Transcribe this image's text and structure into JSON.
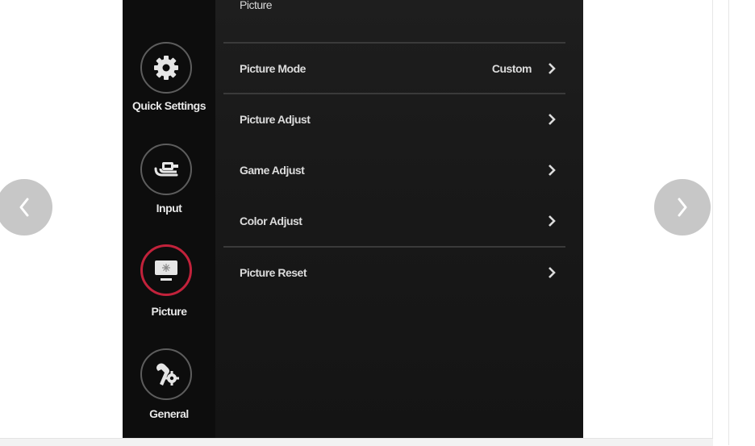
{
  "sidebar": {
    "items": [
      {
        "label": "Quick Settings",
        "icon": "gear-icon"
      },
      {
        "label": "Input",
        "icon": "input-cable-icon"
      },
      {
        "label": "Picture",
        "icon": "monitor-icon",
        "active": true
      },
      {
        "label": "General",
        "icon": "wrench-gear-icon"
      }
    ]
  },
  "menu": {
    "section_title": "Picture",
    "items": [
      {
        "label": "Picture Mode",
        "value": "Custom"
      },
      {
        "label": "Picture Adjust",
        "value": ""
      },
      {
        "label": "Game Adjust",
        "value": ""
      },
      {
        "label": "Color Adjust",
        "value": ""
      },
      {
        "label": "Picture Reset",
        "value": ""
      }
    ]
  },
  "carousel": {
    "prev_icon": "chevron-left-icon",
    "next_icon": "chevron-right-icon"
  },
  "colors": {
    "active_ring": "#c2223b",
    "nav_button": "#c7c7c7"
  }
}
